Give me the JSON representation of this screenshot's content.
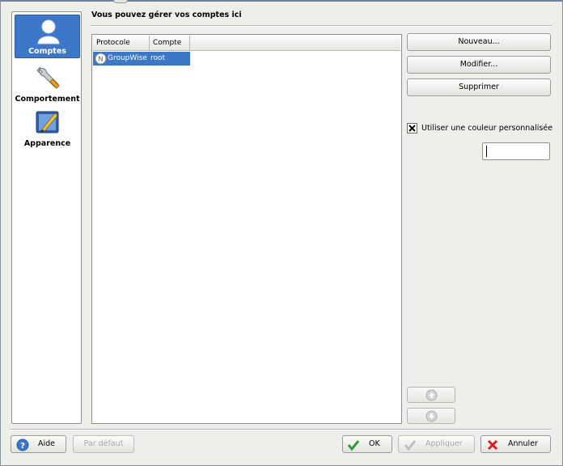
{
  "sidebar": {
    "items": [
      {
        "label": "Comptes",
        "icon": "user-icon",
        "active": true
      },
      {
        "label": "Comportement",
        "icon": "wrench-icon",
        "active": false
      },
      {
        "label": "Apparence",
        "icon": "appearance-icon",
        "active": false
      }
    ]
  },
  "header": {
    "title": "Vous pouvez gérer vos comptes ici"
  },
  "accounts": {
    "columns": [
      "Protocole",
      "Compte"
    ],
    "rows": [
      {
        "protocol": "GroupWise",
        "account": "root",
        "selected": true
      }
    ]
  },
  "actions": {
    "new_label": "Nouveau...",
    "modify_label": "Modifier...",
    "delete_label": "Supprimer"
  },
  "custom_color": {
    "checkbox_label": "Utiliser une couleur personnalisée",
    "checked": true,
    "value": ""
  },
  "footer": {
    "help_label": "Aide",
    "default_label": "Par défaut",
    "ok_label": "OK",
    "apply_label": "Appliquer",
    "cancel_label": "Annuler"
  },
  "colors": {
    "selection": "#3d78c8",
    "background": "#eeeeea"
  }
}
